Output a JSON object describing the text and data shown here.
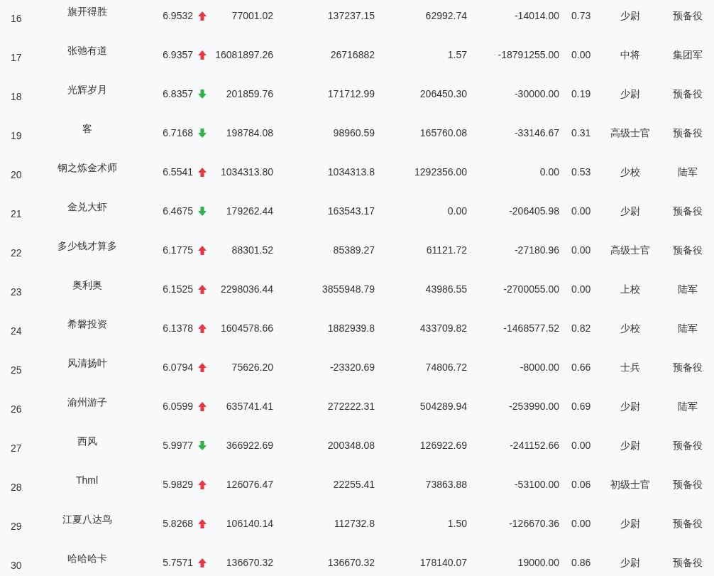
{
  "table": {
    "rows": [
      {
        "cells": [
          "16",
          "旗开得胜",
          "6.9532",
          "77001.02",
          "137237.15",
          "62992.74",
          "-14014.00",
          "0.73",
          "少尉",
          "预备役"
        ],
        "rising": true
      },
      {
        "cells": [
          "17",
          "张弛有道",
          "6.9357",
          "16081897.26",
          "26716882",
          "1.57",
          "-18791255.00",
          "0.00",
          "中将",
          "集团军"
        ],
        "rising": true
      },
      {
        "cells": [
          "18",
          "光辉岁月",
          "6.8357",
          "201859.76",
          "171712.99",
          "206450.30",
          "-30000.00",
          "0.19",
          "少尉",
          "预备役"
        ],
        "rising": false
      },
      {
        "cells": [
          "19",
          "客",
          "6.7168",
          "198784.08",
          "98960.59",
          "165760.08",
          "-33146.67",
          "0.31",
          "高级士官",
          "预备役"
        ],
        "rising": false
      },
      {
        "cells": [
          "20",
          "钢之炼金术师",
          "6.5541",
          "1034313.80",
          "1034313.8",
          "1292356.00",
          "0.00",
          "0.53",
          "少校",
          "陆军"
        ],
        "rising": true
      },
      {
        "cells": [
          "21",
          "金兑大虾",
          "6.4675",
          "179262.44",
          "163543.17",
          "0.00",
          "-206405.98",
          "0.00",
          "少尉",
          "预备役"
        ],
        "rising": false
      },
      {
        "cells": [
          "22",
          "多少钱才算多",
          "6.1775",
          "88301.52",
          "85389.27",
          "61121.72",
          "-27180.96",
          "0.00",
          "高级士官",
          "预备役"
        ],
        "rising": true
      },
      {
        "cells": [
          "23",
          "奥利奥",
          "6.1525",
          "2298036.44",
          "3855948.79",
          "43986.55",
          "-2700055.00",
          "0.00",
          "上校",
          "陆军"
        ],
        "rising": true
      },
      {
        "cells": [
          "24",
          "希磐投资",
          "6.1378",
          "1604578.66",
          "1882939.8",
          "433709.82",
          "-1468577.52",
          "0.82",
          "少校",
          "陆军"
        ],
        "rising": true
      },
      {
        "cells": [
          "25",
          "风清扬叶",
          "6.0794",
          "75626.20",
          "-23320.69",
          "74806.72",
          "-8000.00",
          "0.66",
          "士兵",
          "预备役"
        ],
        "rising": true
      },
      {
        "cells": [
          "26",
          "渝州游子",
          "6.0599",
          "635741.41",
          "272222.31",
          "504289.94",
          "-253990.00",
          "0.69",
          "少尉",
          "陆军"
        ],
        "rising": true
      },
      {
        "cells": [
          "27",
          "西风",
          "5.9977",
          "366922.69",
          "200348.08",
          "126922.69",
          "-241152.66",
          "0.00",
          "少尉",
          "预备役"
        ],
        "rising": false
      },
      {
        "cells": [
          "28",
          "Thml",
          "5.9829",
          "126076.47",
          "22255.41",
          "73863.88",
          "-53100.00",
          "0.06",
          "初级士官",
          "预备役"
        ],
        "rising": true
      },
      {
        "cells": [
          "29",
          "江夏八达鸟",
          "5.8268",
          "106140.14",
          "112732.8",
          "1.50",
          "-126670.36",
          "0.00",
          "少尉",
          "预备役"
        ],
        "rising": true
      },
      {
        "cells": [
          "30",
          "哈哈哈卡",
          "5.7571",
          "136670.32",
          "136670.32",
          "178140.07",
          "19000.00",
          "0.86",
          "少尉",
          "预备役"
        ],
        "rising": true
      }
    ]
  }
}
